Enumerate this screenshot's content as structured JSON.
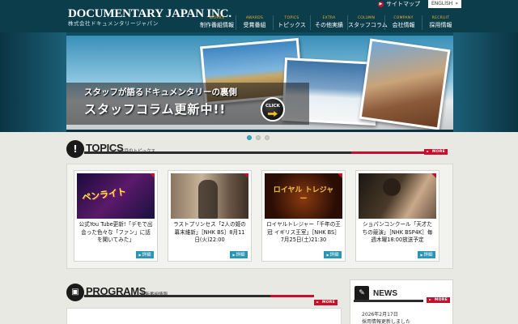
{
  "header": {
    "logo": "DOCUMENTARY JAPAN INC.",
    "logo_sub": "株式会社ドキュメンタリージャパン",
    "sitemap": "サイトマップ",
    "english": "ENGLISH",
    "nav": [
      {
        "en": "WORKS",
        "ja": "制作番組情報"
      },
      {
        "en": "AWARDS",
        "ja": "受賞番組"
      },
      {
        "en": "TOPICS",
        "ja": "トピックス"
      },
      {
        "en": "EXTRA",
        "ja": "その他実績"
      },
      {
        "en": "COLUMN",
        "ja": "スタッフコラム"
      },
      {
        "en": "COMPANY",
        "ja": "会社情報"
      },
      {
        "en": "RECRUIT",
        "ja": "採用情報"
      }
    ]
  },
  "hero": {
    "subtitle": "スタッフが語るドキュメンタリーの裏側",
    "title": "スタッフコラム更新中!!",
    "click": "CLICK"
  },
  "topics": {
    "title": "TOPICS",
    "subtitle": "注目のトピックス",
    "more": "MORE",
    "cards": [
      {
        "text": "公式You Tube更新!「デモで出会った色々な「ファン」に話を聞いてみた」",
        "detail": "詳細",
        "img_text": "ペンライト"
      },
      {
        "text": "ラストプリンセス「2人の姫の幕末維新」［NHK BS］8月11日(火)22:00",
        "detail": "詳細",
        "img_text": ""
      },
      {
        "text": "ロイヤルトレジャー「千年の王冠 イギリス王室」［NHK BS］7月25日(土)21:30",
        "detail": "詳細",
        "img_text": "ロイヤル トレジャー"
      },
      {
        "text": "ショパンコンクール「天才たちの競演」［NHK BSP4K］毎週木曜18:00放送予定",
        "detail": "詳細",
        "img_text": ""
      }
    ]
  },
  "programs": {
    "title": "PROGRAMS",
    "subtitle": "最新番組情報",
    "more": "MORE"
  },
  "news": {
    "title": "NEWS",
    "more": "MORE",
    "date": "2026年2月17日",
    "item": "採用情報更新しました"
  },
  "colors": {
    "header_bg": "#0c3d4b",
    "accent_red": "#c8102e",
    "accent_blue": "#2a95b4",
    "nav_en": "#f0b428"
  }
}
